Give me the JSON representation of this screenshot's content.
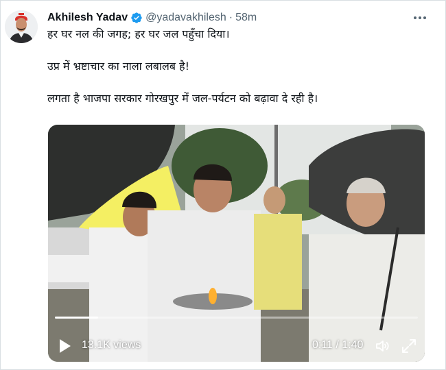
{
  "tweet": {
    "author_name": "Akhilesh Yadav",
    "handle": "@yadavakhilesh",
    "separator": "·",
    "time": "58m",
    "verified": true,
    "lines": [
      "हर घर नल की जगह; हर घर जल पहुँचा दिया।",
      "उप्र में भ्रष्टाचार का नाला लबालब है!",
      "लगता है भाजपा सरकार गोरखपुर में जल-पर्यटन को बढ़ावा दे रही है।"
    ]
  },
  "video": {
    "views": "13.1K views",
    "time_display": "0:11 / 1:40",
    "progress": 0.12
  },
  "icons": {
    "verified": "verified-badge-icon",
    "more": "more-options-icon",
    "play": "play-icon",
    "volume": "volume-icon",
    "fullscreen": "fullscreen-icon"
  },
  "colors": {
    "verified": "#1d9bf0",
    "text_primary": "#0f1419",
    "text_secondary": "#536471"
  }
}
